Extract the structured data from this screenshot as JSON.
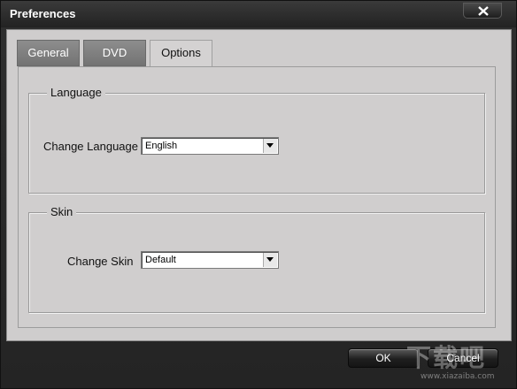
{
  "window": {
    "title": "Preferences"
  },
  "tabs": [
    {
      "label": "General",
      "active": false
    },
    {
      "label": "DVD",
      "active": false
    },
    {
      "label": "Options",
      "active": true
    }
  ],
  "language_group": {
    "title": "Language",
    "field_label": "Change Language",
    "selected": "English"
  },
  "skin_group": {
    "title": "Skin",
    "field_label": "Change Skin",
    "selected": "Default"
  },
  "buttons": {
    "ok": "OK",
    "cancel": "Cancel"
  },
  "watermark": {
    "main": "下载吧",
    "sub": "www.xiazaiba.com"
  },
  "colors": {
    "panel": "#cfcdcd",
    "titlebar": "#2b2b2b",
    "button": "#1f1f1f"
  },
  "icons": {
    "close": "close-icon",
    "dropdown": "chevron-down-icon"
  }
}
